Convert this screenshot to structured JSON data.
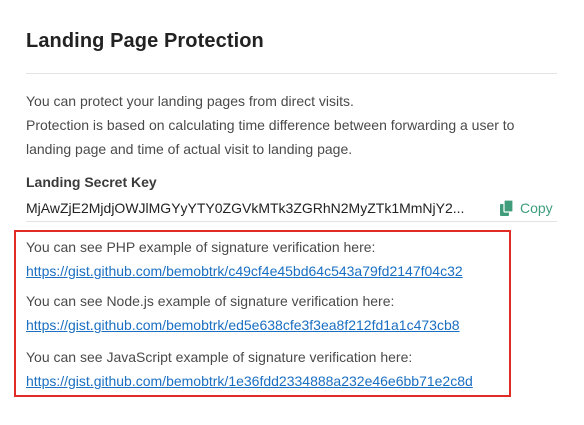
{
  "page": {
    "title": "Landing Page Protection",
    "description_lines": [
      "You can protect your landing pages from direct visits.",
      "Protection is based on calculating time difference between forwarding a user to",
      "landing page and time of actual visit to landing page."
    ]
  },
  "secret_key": {
    "label": "Landing Secret Key",
    "value": "MjAwZjE2MjdjOWJlMGYyYTY0ZGVkMTk3ZGRhN2MyZTk1MmNjY2...",
    "copy_label": "Copy",
    "copy_icon": "copy-icon"
  },
  "examples": [
    {
      "text": "You can see PHP example of signature verification here:",
      "link": "https://gist.github.com/bemobtrk/c49cf4e45bd64c543a79fd2147f04c32"
    },
    {
      "text": "You can see Node.js example of signature verification here:",
      "link": "https://gist.github.com/bemobtrk/ed5e638cfe3f3ea8f212fd1a1c473cb8"
    },
    {
      "text": "You can see JavaScript example of signature verification here:",
      "link": "https://gist.github.com/bemobtrk/1e36fdd2334888a232e46e6bb71e2c8d"
    }
  ],
  "colors": {
    "accent_green": "#3f9d7c",
    "link_blue": "#1a6fc2",
    "highlight_red": "#e02b27"
  }
}
